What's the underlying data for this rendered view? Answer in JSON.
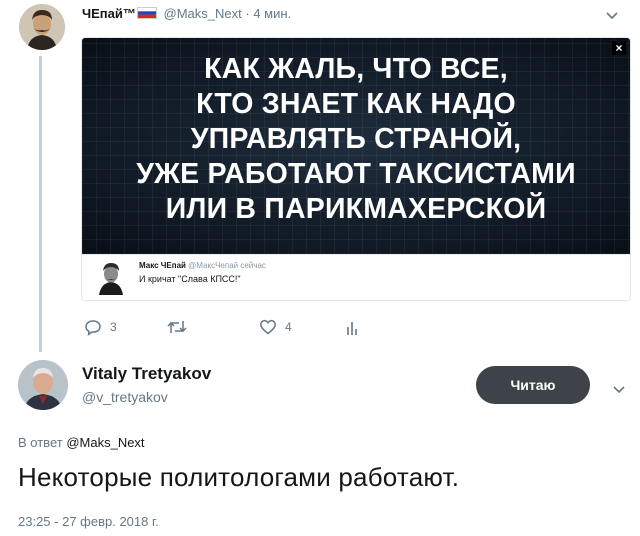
{
  "original_tweet": {
    "author_name": "ЧЕпай™",
    "handle": "@Maks_Next",
    "separator": "·",
    "time": "4 мин.",
    "flag_icon": "russian-flag-icon",
    "poster": {
      "lines": [
        "КАК ЖАЛЬ, ЧТО ВСЕ,",
        "КТО ЗНАЕТ КАК НАДО",
        "УПРАВЛЯТЬ СТРАНОЙ,",
        "УЖЕ РАБОТАЮТ ТАКСИСТАМИ",
        "ИЛИ В ПАРИКМАХЕРСКОЙ"
      ],
      "close_symbol": "×",
      "caption": {
        "name": "Макс ЧЕпай",
        "handle": "@МаксЧепай",
        "time": "сейчас",
        "text": "И кричат \"Слава КПСС!\""
      }
    },
    "actions": {
      "reply_count": "3",
      "retweet_count": "",
      "like_count": "4"
    }
  },
  "reply_tweet": {
    "author_name": "Vitaly Tretyakov",
    "handle": "@v_tretyakov",
    "follow_button": "Читаю",
    "reply_to_prefix": "В ответ",
    "reply_to_handle": "@Maks_Next",
    "text": "Некоторые политологами работают.",
    "timestamp": "23:25 - 27 февр. 2018 г."
  },
  "colors": {
    "text_primary": "#14171a",
    "text_secondary": "#657786",
    "thread_line": "#c4cfd6",
    "follow_button_bg": "#3d4348",
    "poster_bg": "#0f1823"
  }
}
